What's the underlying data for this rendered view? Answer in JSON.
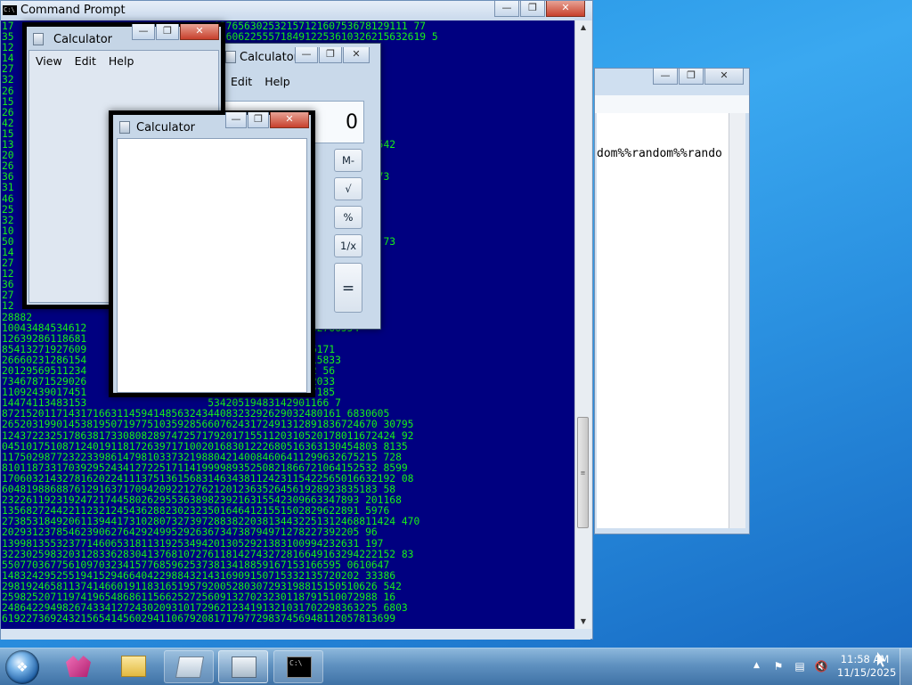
{
  "cmd": {
    "title": "Command Prompt",
    "icon_label": "C:\\",
    "lines": [
      "17                                 02765630253215712160753678129111 77",
      "35                                 12606225557184912253610326215632619 5",
      "12                                               8201385991",
      "14                                               857536710319",
      "27                                               2277062066 2",
      "32                                               0061073572 83",
      "26                                               174927665",
      "15                                               18255683",
      "26                                               19028711",
      "42                                               1728793 4673",
      "15                                               462325319554",
      "13                                               2114993091326542",
      "20                                               4826228857 0",
      "26                                               471110931905",
      "36                                               839230252236 73",
      "31                                               431403222094",
      "46                                               72847813839",
      "25                                               1409622009",
      "32                                               3091150526585",
      "10                                               163622466",
      "50                                               2404614200225 73",
      "14                                               256432995",
      "27                                               862380025321",
      "12                                               8272898513575",
      "36                                               1927126716",
      "27                                               540415293",
      "12                                               91299931860",
      "28882                                            9841140815453",
      "10043484534612                                   8132766554",
      "12639286118681                    6226143216830522",
      "85413271927609                    7655614360221041 6171",
      "26660231286154                    6100897915525197715833",
      "20129569511234                    138453301178032132 56",
      "73467871529026                    1615432304116462 2033",
      "11092439017451                    611943734221980417185",
      "14474113483153                    53420519483142901166 7",
      "87215201171431716631145941485632434408323292629032480161 6830605",
      "26520319901453819507197751035928566076243172491312891836724670 30795",
      "12437223251786381733080828974725717920171551120310520178011672424 92",
      "04510175108712401911817263971710020168301222680516363130454803 8135",
      "11750298772322339861479810337321988042140084606411299632675215 728",
      "81011873317039295243412722517114199998935250821866721064152532 8599",
      "17060321432781620224111375136156831463438112423115422565016632192 08",
      "60481988688761291637170942092212762120123635264561928923835183 58",
      "23226119231924721744580262955363898239216315542309663347893 201168",
      "13568272442211232124543628823023235016464121551502829622891 5976",
      "27385318492061139441731028073273972883822038134432251312468811424 470",
      "20293123785462390627642924995292636734738794971278227392205 96",
      "13998135532377146065318113192534942013052921383100994232631 197",
      "32230259832031283362830413768107276118142743272816649163294222152 83",
      "55077036775610970323415776859625373813418859167153166595 0610647",
      "14832429525519415294664042298843214316909150715332135720202 33386",
      "29819246581137414660191183165195792005280307293198815150510626 542",
      "25982520711974196548686115662527256091327023230118791510072988 16",
      "24864229498267433412724302093101729621234191321031702298363225 6803",
      "61922736924321565414560294110679208171797729837456948112057813699"
    ]
  },
  "notepad": {
    "visible_text": "dom%%random%%rando"
  },
  "calc_back": {
    "title": "Calculator",
    "menu": [
      "Edit",
      "Help"
    ],
    "display": "0",
    "keys": [
      "M-",
      "√",
      "%",
      "1/x",
      "="
    ]
  },
  "calc_mid": {
    "title": "Calculator",
    "menu": [
      "View",
      "Edit",
      "Help"
    ]
  },
  "calc_front": {
    "title": "Calculator"
  },
  "taskbar": {
    "start_label": "Start",
    "items": [
      "paint",
      "explorer",
      "notepad",
      "calculator",
      "command-prompt"
    ],
    "clock_time": "11:58 AM",
    "clock_date": "11/15/2025"
  }
}
